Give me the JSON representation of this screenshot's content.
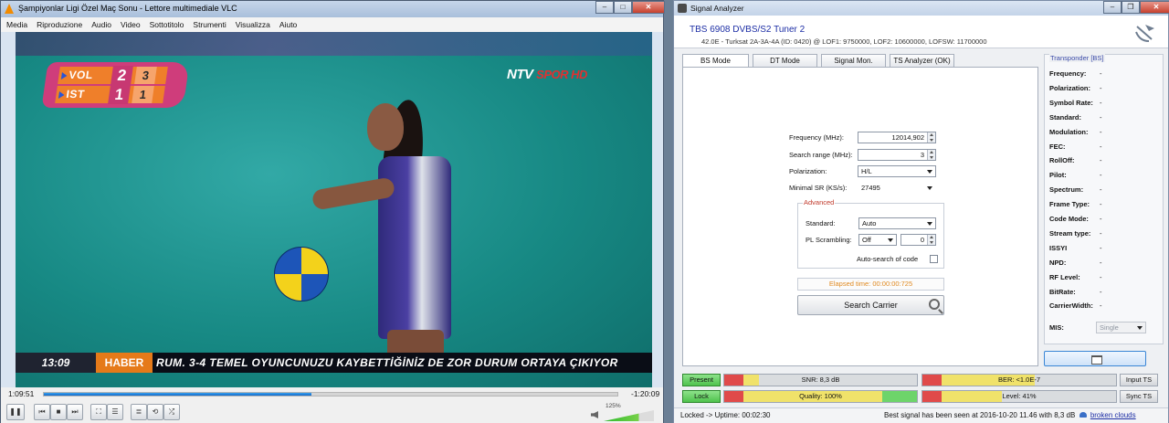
{
  "vlc": {
    "title": "Şampiyonlar Ligi Özel Maç Sonu - Lettore multimediale VLC",
    "menu": [
      "Media",
      "Riproduzione",
      "Audio",
      "Video",
      "Sottotitolo",
      "Strumenti",
      "Visualizza",
      "Aiuto"
    ],
    "video": {
      "scoreboard": {
        "home_team": "VOL",
        "home_sets": "2",
        "home_points": "3",
        "away_team": "IST",
        "away_sets": "1",
        "away_points": "1"
      },
      "channel_logo": "NTV",
      "channel_logo_b": "SPOR HD",
      "ticker_time": "13:09",
      "ticker_tag": "HABER",
      "ticker_text": "RUM. 3-4 TEMEL OYUNCUNUZU KAYBETTİĞİNİZ DE ZOR DURUM ORTAYA ÇIKIYOR"
    },
    "playback": {
      "current_time": "1:09:51",
      "remaining_time": "-1:20:09",
      "progress_fraction": 0.466,
      "volume_label": "125%",
      "volume_fraction": 0.7
    },
    "controls": [
      "pause-icon",
      "prev-icon",
      "stop-icon",
      "next-icon",
      "fullscreen-icon",
      "extended-settings-icon",
      "playlist-icon",
      "loop-icon",
      "shuffle-icon"
    ]
  },
  "analyzer": {
    "title": "Signal Analyzer",
    "device_name": "TBS 6908 DVBS/S2 Tuner 2",
    "device_info": "42.0E - Turksat 2A-3A-4A (ID: 0420) @ LOF1: 9750000, LOF2: 10600000, LOFSW: 11700000",
    "tabs": [
      "BS Mode",
      "DT Mode",
      "Signal Mon.",
      "TS Analyzer (OK)"
    ],
    "active_tab": "BS Mode",
    "form": {
      "frequency_label": "Frequency (MHz):",
      "frequency_value": "12014,902",
      "search_range_label": "Search range (MHz):",
      "search_range_value": "3",
      "polarization_label": "Polarization:",
      "polarization_value": "H/L",
      "minimal_sr_label": "Minimal SR (KS/s):",
      "minimal_sr_value": "27495",
      "advanced_label": "Advanced",
      "standard_label": "Standard:",
      "standard_value": "Auto",
      "pl_scrambling_label": "PL Scrambling:",
      "pl_scrambling_value": "Off",
      "pl_scrambling_code": "0",
      "auto_search_label": "Auto-search of code",
      "elapsed": "Elapsed time: 00:00:00:725",
      "search_button": "Search Carrier"
    },
    "transponder": {
      "title": "Transponder [BS]",
      "fields": [
        {
          "label": "Frequency:",
          "value": "-"
        },
        {
          "label": "Polarization:",
          "value": "-"
        },
        {
          "label": "Symbol Rate:",
          "value": "-"
        },
        {
          "label": "Standard:",
          "value": "-"
        },
        {
          "label": "Modulation:",
          "value": "-"
        },
        {
          "label": "FEC:",
          "value": "-"
        },
        {
          "label": "RollOff:",
          "value": "-"
        },
        {
          "label": "Pilot:",
          "value": "-"
        },
        {
          "label": "Spectrum:",
          "value": "-"
        },
        {
          "label": "Frame Type:",
          "value": "-"
        },
        {
          "label": "Code Mode:",
          "value": "-"
        },
        {
          "label": "Stream type:",
          "value": "-"
        },
        {
          "label": "ISSYI",
          "value": "-"
        },
        {
          "label": "NPD:",
          "value": "-"
        },
        {
          "label": "RF Level:",
          "value": "-"
        },
        {
          "label": "BitRate:",
          "value": "-"
        },
        {
          "label": "CarrierWidth:",
          "value": "-"
        }
      ],
      "mis_label": "MIS:",
      "mis_value": "Single"
    },
    "indicators": {
      "present": "Present",
      "lock": "Lock",
      "input_ts": "Input TS",
      "sync_ts": "Sync TS",
      "snr": "SNR: 8,3 dB",
      "snr_fraction": 0.18,
      "ber": "BER: <1.0E-7",
      "ber_fraction": 0.58,
      "quality": "Quality: 100%",
      "quality_fraction": 1.0,
      "level": "Level: 41%",
      "level_fraction": 0.41
    },
    "status_left": "Locked -> Uptime: 00:02:30",
    "status_right": "Best signal has been seen at 2016-10-20 11.46 with 8,3 dB",
    "status_link": "broken clouds"
  }
}
